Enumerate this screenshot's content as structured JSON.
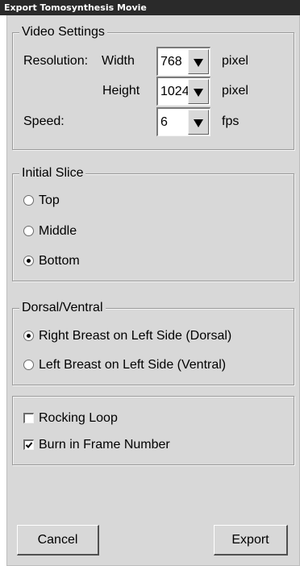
{
  "window": {
    "title": "Export Tomosynthesis Movie"
  },
  "video_settings": {
    "title": "Video Settings",
    "resolution_label": "Resolution:",
    "width_label": "Width",
    "width_value": "768",
    "width_unit": "pixel",
    "height_label": "Height",
    "height_value": "1024",
    "height_unit": "pixel",
    "speed_label": "Speed:",
    "speed_value": "6",
    "speed_unit": "fps",
    "dropdown_icon": "triangle-down-icon"
  },
  "initial_slice": {
    "title": "Initial Slice",
    "options": [
      {
        "label": "Top",
        "checked": false
      },
      {
        "label": "Middle",
        "checked": false
      },
      {
        "label": "Bottom",
        "checked": true
      }
    ]
  },
  "orientation": {
    "title": "Dorsal/Ventral",
    "options": [
      {
        "label": "Right Breast on Left Side (Dorsal)",
        "checked": true
      },
      {
        "label": "Left Breast on Left Side (Ventral)",
        "checked": false
      }
    ]
  },
  "options": {
    "rocking_loop": {
      "label": "Rocking Loop",
      "checked": false
    },
    "burn_frame_number": {
      "label": "Burn in Frame Number",
      "checked": true
    }
  },
  "buttons": {
    "cancel": "Cancel",
    "export": "Export"
  },
  "colors": {
    "title_bar": "#2a2a2a",
    "dialog_face": "#d8d8d8",
    "field_background": "#ffffff"
  }
}
